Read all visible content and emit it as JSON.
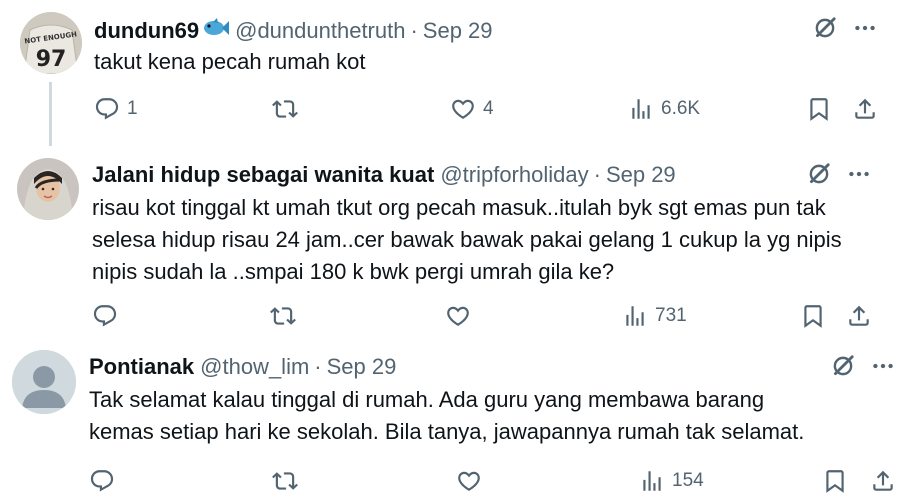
{
  "tweets": [
    {
      "name": "dundun69",
      "handle": "@dundunthetruth",
      "date": "Sep 29",
      "text": [
        "takut kena pecah rumah kot"
      ],
      "replies": "1",
      "retweets": "",
      "likes": "4",
      "views": "6.6K",
      "avatar_jersey_text": "NOT ENOUGH",
      "avatar_jersey_number": "97"
    },
    {
      "name": "Jalani hidup sebagai wanita kuat",
      "handle": "@tripforholiday",
      "date": "Sep 29",
      "text": [
        "risau kot tinggal kt umah tkut org pecah masuk..itulah byk sgt emas pun tak",
        "selesa hidup risau 24 jam..cer bawak bawak pakai gelang 1 cukup la yg nipis",
        "nipis sudah la ..smpai 180 k bwk pergi umrah gila ke?"
      ],
      "replies": "",
      "retweets": "",
      "likes": "",
      "views": "731"
    },
    {
      "name": "Pontianak",
      "handle": "@thow_lim",
      "date": "Sep 29",
      "text": [
        "Tak selamat kalau tinggal di rumah. Ada  guru yang membawa barang",
        "kemas setiap hari ke sekolah. Bila tanya, jawapannya rumah tak selamat."
      ],
      "replies": "",
      "retweets": "",
      "likes": "",
      "views": "154"
    }
  ],
  "separator": "·",
  "colors": {
    "text": "#0f1419",
    "secondary": "#536471",
    "thread": "#cfd9de",
    "avatar_default": "#8b98a5"
  },
  "icons": [
    "grok-icon",
    "more-icon",
    "reply-icon",
    "retweet-icon",
    "like-icon",
    "views-icon",
    "bookmark-icon",
    "share-icon",
    "fish-emoji-icon"
  ]
}
